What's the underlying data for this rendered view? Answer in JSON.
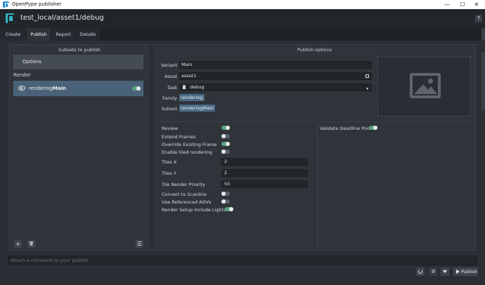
{
  "window": {
    "title": "OpenPype publisher",
    "minimize": "—",
    "maximize": "☐",
    "close": "✕"
  },
  "header": {
    "context": "test_local/asset1/debug",
    "help": "?"
  },
  "tabs": [
    {
      "label": "Create"
    },
    {
      "label": "Publish"
    },
    {
      "label": "Report"
    },
    {
      "label": "Details"
    }
  ],
  "active_tab": "Publish",
  "left_panel": {
    "heading": "Subsets to publish",
    "options_button": "Options",
    "group": "Render",
    "instance": {
      "name_prefix": "rendering",
      "name_bold": "Main",
      "enabled": true
    },
    "buttons": {
      "add": "+",
      "delete": "🗑",
      "menu": "☰"
    }
  },
  "right_panel": {
    "heading": "Publish options",
    "attributes": {
      "variant_label": "Variant",
      "variant_value": "Main",
      "asset_label": "Asset",
      "asset_value": "asset1",
      "task_label": "Task",
      "task_value": "debug",
      "family_label": "Family",
      "family_value": "rendering",
      "subset_label": "Subset",
      "subset_value": "renderingMain"
    },
    "plugin_options": [
      {
        "label": "Review",
        "type": "toggle",
        "value": true
      },
      {
        "label": "Extend Frames",
        "type": "toggle",
        "value": false
      },
      {
        "label": "Override Existing Frame",
        "type": "toggle",
        "value": true
      },
      {
        "label": "Enable tiled rendering",
        "type": "toggle",
        "value": false
      },
      {
        "label": "Tiles X",
        "type": "number",
        "value": "2"
      },
      {
        "label": "Tiles Y",
        "type": "number",
        "value": "2"
      },
      {
        "label": "Tile Render Priority",
        "type": "number",
        "value": "50"
      },
      {
        "label": "Convert to Scanline",
        "type": "toggle",
        "value": false
      },
      {
        "label": "Use Referenced AOVs",
        "type": "toggle",
        "value": false
      },
      {
        "label": "Render Setup Include Lights",
        "type": "toggle",
        "value": true
      }
    ],
    "deadline": {
      "label": "Validate Deadline Pools",
      "value": true
    }
  },
  "comment": {
    "placeholder": "Attach a comment to your publish"
  },
  "footer": {
    "publish_label": "Publish"
  }
}
